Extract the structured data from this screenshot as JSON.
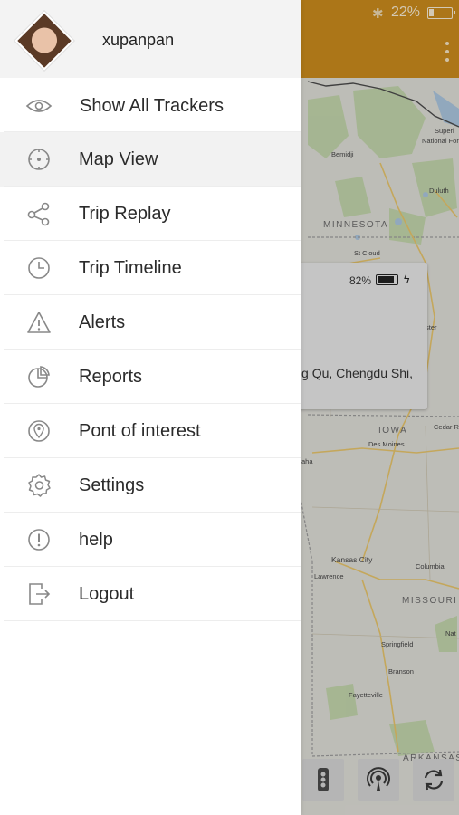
{
  "status_bar": {
    "battery_percent": "22%"
  },
  "user": {
    "name": "xupanpan"
  },
  "menu": {
    "items": [
      {
        "label": "Show All Trackers",
        "icon": "eye-icon"
      },
      {
        "label": "Map View",
        "icon": "crosshair-icon",
        "active": true
      },
      {
        "label": "Trip Replay",
        "icon": "share-nodes-icon"
      },
      {
        "label": "Trip Timeline",
        "icon": "clock-icon"
      },
      {
        "label": "Alerts",
        "icon": "warning-icon"
      },
      {
        "label": "Reports",
        "icon": "pie-chart-icon"
      },
      {
        "label": "Pont of interest",
        "icon": "location-pin-icon"
      },
      {
        "label": "Settings",
        "icon": "gear-icon"
      },
      {
        "label": "help",
        "icon": "exclamation-circle-icon"
      },
      {
        "label": "Logout",
        "icon": "logout-icon"
      }
    ]
  },
  "map": {
    "labels": {
      "minnesota": "MINNESOTA",
      "iowa": "IOWA",
      "missouri": "MISSOURI",
      "arkansas": "ARKANSAS",
      "superior": "Superi",
      "national_for": "National For",
      "duluth": "Duluth",
      "bemidji": "Bemidji",
      "st_cloud": "St Cloud",
      "rochester": "ster",
      "des_moines": "Des Moines",
      "cedar_rapids": "Cedar R",
      "kansas_city": "Kansas City",
      "lawrence": "Lawrence",
      "columbia": "Columbia",
      "springfield": "Springfield",
      "branson": "Branson",
      "fayetteville": "Fayetteville",
      "omaha": "aha",
      "nat": "Nat"
    },
    "info_card": {
      "battery_percent": "82%",
      "address": "g Qu, Chengdu Shi,"
    }
  },
  "colors": {
    "header_orange": "#c98a1c",
    "drawer_bg": "#ffffff",
    "active_item_bg": "#f2f2f2"
  }
}
